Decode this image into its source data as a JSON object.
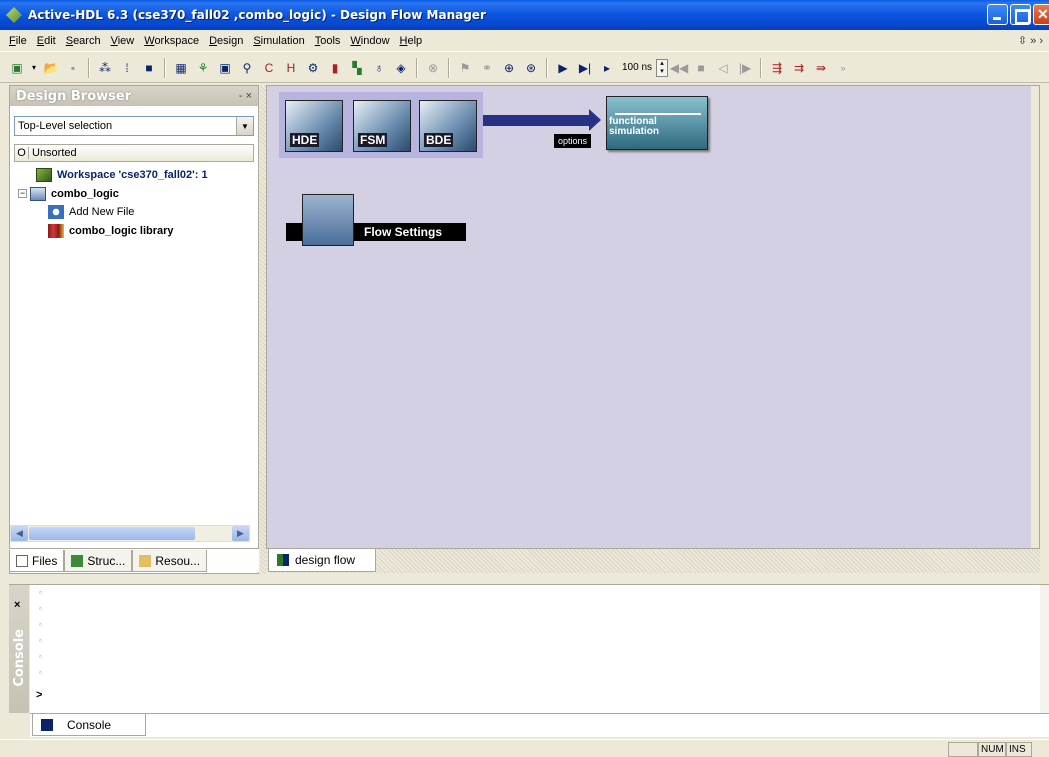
{
  "window": {
    "title": "Active-HDL 6.3 (cse370_fall02 ,combo_logic) - Design Flow Manager"
  },
  "menu": {
    "items": [
      "File",
      "Edit",
      "Search",
      "View",
      "Workspace",
      "Design",
      "Simulation",
      "Tools",
      "Window",
      "Help"
    ],
    "extra": "⇳ » ›"
  },
  "toolbar": {
    "sim_time": "100 ns"
  },
  "design_browser": {
    "title": "Design Browser",
    "close_label": "- ×",
    "selection": "Top-Level selection",
    "column_o": "O",
    "column_label": "Unsorted",
    "tree": [
      {
        "label": "Workspace 'cse370_fall02': 1",
        "icon": "workspace-icon"
      },
      {
        "label": "combo_logic",
        "icon": "design-icon"
      },
      {
        "label": "Add New File",
        "icon": "add-file-icon"
      },
      {
        "label": "combo_logic library",
        "icon": "library-icon"
      }
    ],
    "tabs": [
      "Files",
      "Struc...",
      "Resou..."
    ]
  },
  "design_flow": {
    "tiles": [
      "HDE",
      "FSM",
      "BDE"
    ],
    "options_label": "options",
    "functional_simulation": "functional\nsimulation",
    "flow_settings": "Flow Settings",
    "tab": "design flow"
  },
  "console": {
    "side_label": "Console",
    "close_label": "×",
    "lines": [
      "▫",
      "▫",
      "▫",
      "▫",
      "▫",
      "▫"
    ],
    "prompt": ">",
    "tab": "Console"
  },
  "statusbar": {
    "num": "NUM",
    "ins": "INS"
  }
}
